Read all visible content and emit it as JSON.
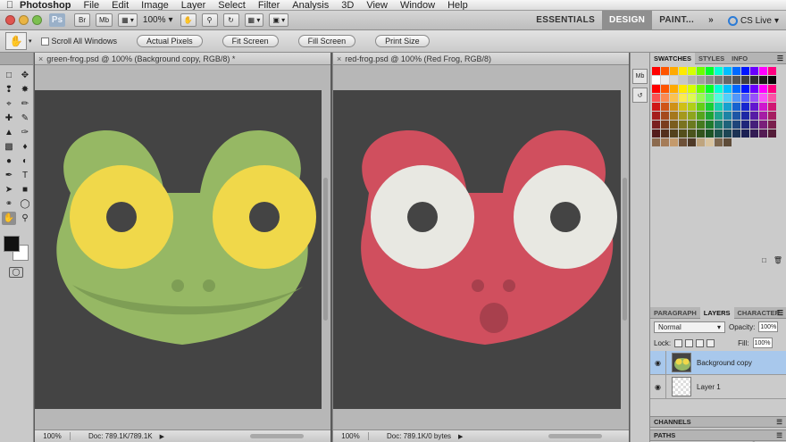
{
  "menubar": {
    "app_name": "Photoshop",
    "items": [
      "File",
      "Edit",
      "Image",
      "Layer",
      "Select",
      "Filter",
      "Analysis",
      "3D",
      "View",
      "Window",
      "Help"
    ]
  },
  "appbar": {
    "logo": "Ps",
    "mini_bridge": "Mb",
    "zoom_value": "100%",
    "workspaces": [
      "ESSENTIALS",
      "DESIGN",
      "PAINT..."
    ],
    "active_workspace": "DESIGN",
    "more": "»",
    "cs_live": "CS Live"
  },
  "options": {
    "scroll_all": "Scroll All Windows",
    "buttons": [
      "Actual Pixels",
      "Fit Screen",
      "Fill Screen",
      "Print Size"
    ]
  },
  "documents": [
    {
      "tab": "green-frog.psd @ 100% (Background copy, RGB/8) *",
      "zoom": "100%",
      "doc_info": "Doc: 789.1K/789.1K",
      "colors": {
        "head": "#96b864",
        "eye": "#f0d84a",
        "pupil": "#444444",
        "mouth": "#7e9e55"
      }
    },
    {
      "tab": "red-frog.psd @ 100% (Red Frog, RGB/8)",
      "zoom": "100%",
      "doc_info": "Doc: 789.1K/0 bytes",
      "colors": {
        "head": "#d04f5e",
        "eye": "#e8e8e2",
        "pupil": "#444444",
        "mouth": "#a8404d"
      }
    }
  ],
  "swatches": {
    "tabs": [
      "SWATCHES",
      "STYLES",
      "INFO"
    ],
    "active": "SWATCHES"
  },
  "layers": {
    "tabs": [
      "PARAGRAPH",
      "LAYERS",
      "CHARACTER"
    ],
    "active": "LAYERS",
    "blend_mode": "Normal",
    "opacity_label": "Opacity:",
    "opacity_value": "100%",
    "lock_label": "Lock:",
    "fill_label": "Fill:",
    "fill_value": "100%",
    "items": [
      {
        "name": "Background copy",
        "selected": true
      },
      {
        "name": "Layer 1",
        "selected": false
      }
    ]
  },
  "collapsed_panels": [
    "CHANNELS",
    "PATHS"
  ]
}
